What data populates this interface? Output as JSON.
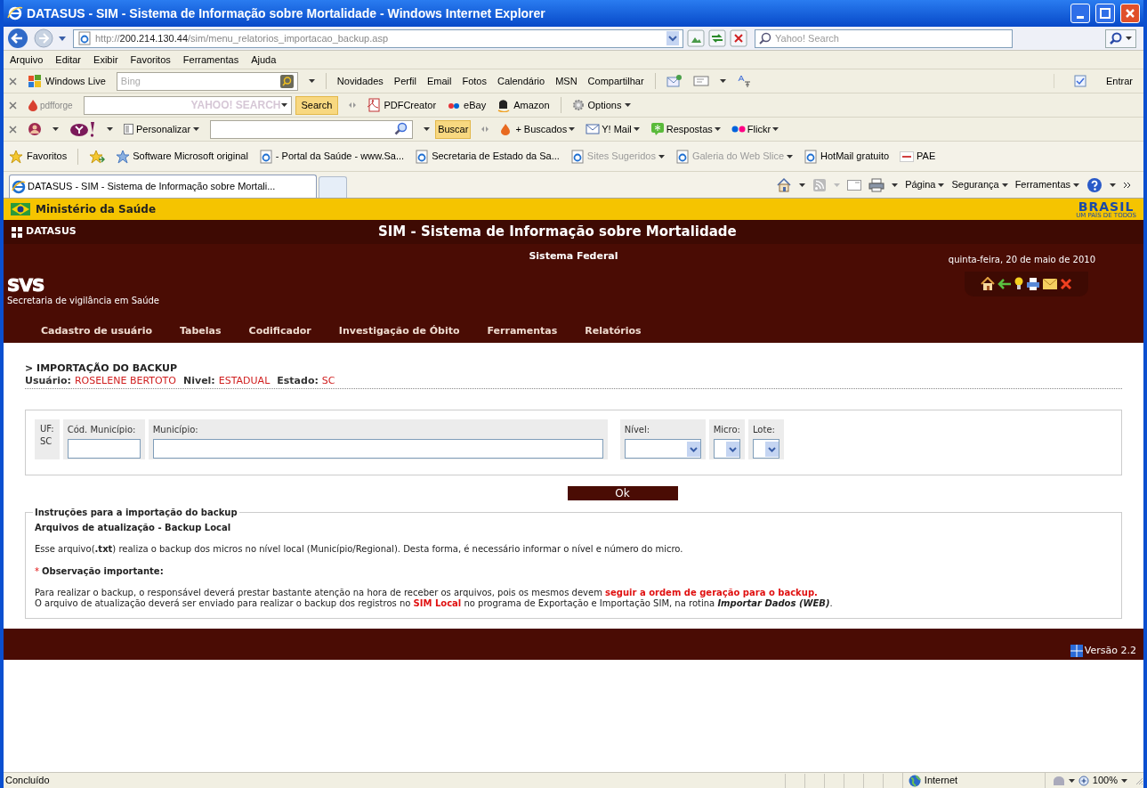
{
  "window": {
    "title": "DATASUS - SIM - Sistema de Informação sobre Mortalidade - Windows Internet Explorer"
  },
  "address_bar": {
    "url_scheme": "http://",
    "url_host": "200.214.130.44",
    "url_path": "/sim/menu_relatorios_importacao_backup.asp",
    "search_placeholder": "Yahoo! Search"
  },
  "menu_bar": [
    "Arquivo",
    "Editar",
    "Exibir",
    "Favoritos",
    "Ferramentas",
    "Ajuda"
  ],
  "windows_live_toolbar": {
    "brand": "Windows Live",
    "search_placeholder": "Bing",
    "links": [
      "Novidades",
      "Perfil",
      "Email",
      "Fotos",
      "Calendário",
      "MSN",
      "Compartilhar"
    ],
    "sign_in": "Entrar"
  },
  "pdfforge_toolbar": {
    "brand": "pdfforge",
    "search_placeholder": "YAHOO! SEARCH",
    "search_button": "Search",
    "links": [
      "PDFCreator",
      "eBay",
      "Amazon"
    ],
    "options": "Options"
  },
  "yahoo_toolbar": {
    "personalize": "Personalizar",
    "search_button": "Buscar",
    "links": [
      "+ Buscados",
      "Y! Mail",
      "Respostas",
      "Flickr"
    ]
  },
  "favorites_bar": {
    "label": "Favoritos",
    "items": [
      {
        "label": "Software Microsoft original",
        "dimmed": false,
        "dropdown": false
      },
      {
        "label": "- Portal da Saúde - www.Sa...",
        "dimmed": false,
        "dropdown": false
      },
      {
        "label": "Secretaria de Estado da Sa...",
        "dimmed": false,
        "dropdown": false
      },
      {
        "label": "Sites Sugeridos",
        "dimmed": true,
        "dropdown": true
      },
      {
        "label": "Galeria do Web Slice",
        "dimmed": true,
        "dropdown": true
      },
      {
        "label": "HotMail gratuito",
        "dimmed": false,
        "dropdown": false
      },
      {
        "label": "PAE",
        "dimmed": false,
        "dropdown": false
      }
    ]
  },
  "tabs": [
    {
      "label": "DATASUS - SIM - Sistema de Informação sobre Mortali...",
      "selected": true
    }
  ],
  "command_bar": [
    "Página",
    "Segurança",
    "Ferramentas"
  ],
  "page": {
    "gov_bar": {
      "title": "Ministério da Saúde",
      "brasil_logo": "BRASIL",
      "brasil_tagline": "UM PAÍS DE TODOS"
    },
    "header": {
      "logo": "DATASUS",
      "title": "SIM - Sistema de Informação sobre Mortalidade",
      "subtitle": "Sistema Federal",
      "date": "quinta-feira, 20 de maio de 2010",
      "svs_logo": "SVS",
      "svs_caption": "Secretaria de vigilância em Saúde"
    },
    "nav": [
      "Cadastro de usuário",
      "Tabelas",
      "Codificador",
      "Investigação de Óbito",
      "Ferramentas",
      "Relatórios"
    ],
    "section_title": "> IMPORTAÇÃO DO BACKUP",
    "user_info": [
      {
        "label": "Usuário:",
        "value": "ROSELENE BERTOTO"
      },
      {
        "label": "Nivel:",
        "value": "ESTADUAL"
      },
      {
        "label": "Estado:",
        "value": "SC"
      }
    ],
    "filters": {
      "uf_label": "UF:",
      "uf_value": "SC",
      "fields": [
        {
          "label": "Cód. Município:",
          "kind": "text"
        },
        {
          "label": "Município:",
          "kind": "text"
        },
        {
          "label": "Nível:",
          "kind": "select"
        },
        {
          "label": "Micro:",
          "kind": "select"
        },
        {
          "label": "Lote:",
          "kind": "select"
        }
      ]
    },
    "ok_button": "Ok",
    "instructions": {
      "legend": "Instruções para a importação do backup",
      "heading": "Arquivos de atualização - Backup Local",
      "blocks": [
        {
          "kind": "text",
          "segments": [
            {
              "kind": "normal",
              "text": "Esse arquivo("
            },
            {
              "kind": "bold",
              "text": ".txt"
            },
            {
              "kind": "normal",
              "text": ") realiza o backup dos micros no nível local (Município/Regional). Desta forma, é necessário informar o nível e número do micro."
            }
          ]
        },
        {
          "kind": "note",
          "marker": "*",
          "text": "Observação importante:"
        },
        {
          "kind": "text",
          "segments": [
            {
              "kind": "normal",
              "text": "Para realizar o backup, o responsável deverá prestar bastante atenção na hora de receber os arquivos, pois os mesmos devem "
            },
            {
              "kind": "red-bold",
              "text": "seguir a ordem de geração para o backup."
            }
          ]
        },
        {
          "kind": "continuation",
          "segments": [
            {
              "kind": "normal",
              "text": "O arquivo de atualização deverá ser enviado para realizar o backup dos registros no "
            },
            {
              "kind": "red-bold",
              "text": "SIM Local"
            },
            {
              "kind": "normal",
              "text": " no programa de Exportação e Importação SIM, na rotina "
            },
            {
              "kind": "bold-italic",
              "text": "Importar Dados (WEB)"
            },
            {
              "kind": "normal",
              "text": "."
            }
          ]
        }
      ]
    },
    "footer": {
      "version": "Versão 2.2"
    }
  },
  "status_bar": {
    "text": "Concluído",
    "zone": "Internet",
    "zoom": "100%"
  }
}
